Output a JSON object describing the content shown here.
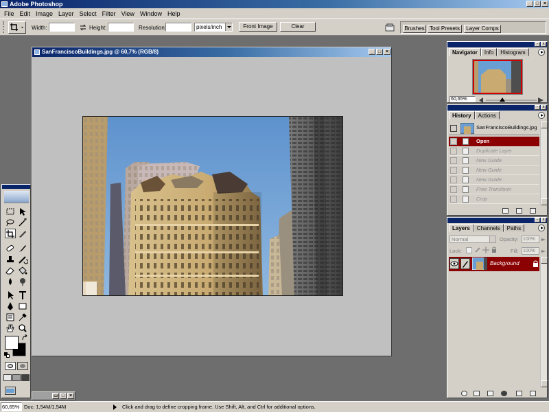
{
  "app": {
    "title": "Adobe Photoshop"
  },
  "menu": [
    "File",
    "Edit",
    "Image",
    "Layer",
    "Select",
    "Filter",
    "View",
    "Window",
    "Help"
  ],
  "options": {
    "width_label": "Width:",
    "height_label": "Height:",
    "resolution_label": "Resolution:",
    "width_value": "",
    "height_value": "",
    "resolution_value": "",
    "units_value": "pixels/inch",
    "front_image_label": "Front Image",
    "clear_label": "Clear",
    "well_tabs": [
      "Brushes",
      "Tool Presets",
      "Layer Comps"
    ]
  },
  "document": {
    "title": "SanFranciscoBuildings.jpg @ 60,7% (RGB/8)"
  },
  "navigator": {
    "tabs": [
      "Navigator",
      "Info",
      "Histogram"
    ],
    "zoom": "60,65%"
  },
  "history": {
    "tabs": [
      "History",
      "Actions"
    ],
    "snapshot": "SanFranciscoBuildings.jpg",
    "items": [
      "Open",
      "Duplicate Layer",
      "New Guide",
      "New Guide",
      "New Guide",
      "Free Transform",
      "Crop"
    ]
  },
  "layers": {
    "tabs": [
      "Layers",
      "Channels",
      "Paths"
    ],
    "blend_mode": "Normal",
    "opacity_label": "Opacity:",
    "opacity_value": "100%",
    "lock_label": "Lock:",
    "fill_label": "Fill:",
    "fill_value": "100%",
    "layer_name": "Background"
  },
  "status": {
    "zoom": "60,65%",
    "doc_size": "Doc: 1,54M/1,54M",
    "message": "Click and drag to define cropping frame. Use Shift, Alt, and Ctrl for additional options."
  },
  "colors": {
    "titlebar": "#0a246a",
    "chrome": "#d4d0c8",
    "workspace": "#6e6e6e",
    "history_active": "#8b0000",
    "layer_active": "#8b0000"
  },
  "icons": [
    "photoshop-logo",
    "crop-icon",
    "swap-icon",
    "trash-icon",
    "new-layer-icon",
    "eye-icon",
    "brush-icon",
    "lock-icon",
    "menu-arrow-icon"
  ]
}
